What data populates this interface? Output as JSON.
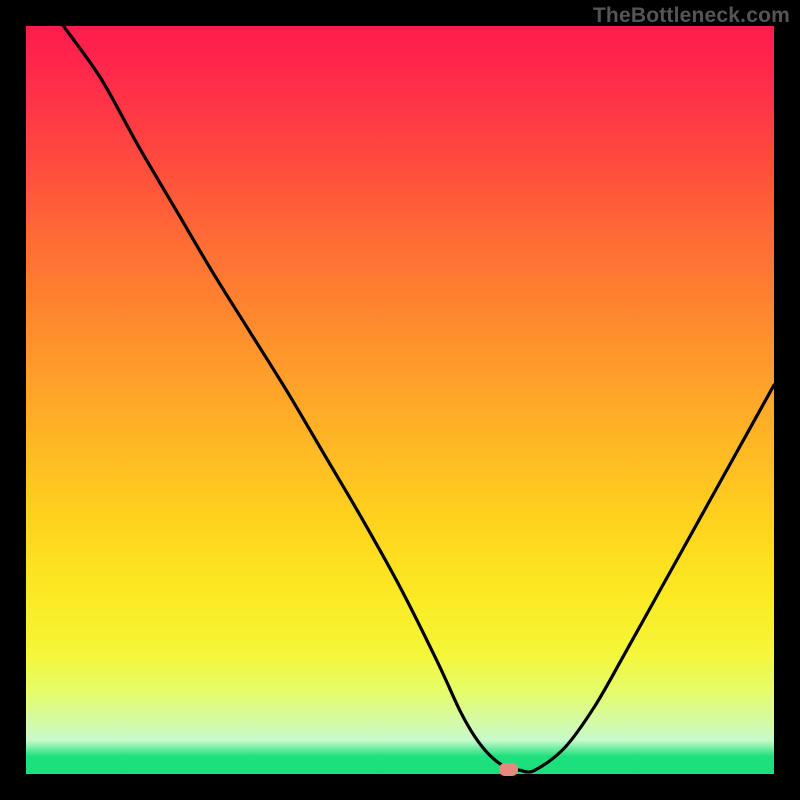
{
  "watermark": "TheBottleneck.com",
  "marker": {
    "x_pct": 64.5,
    "y_pct": 100
  },
  "chart_data": {
    "type": "line",
    "title": "",
    "xlabel": "",
    "ylabel": "",
    "xlim": [
      0,
      100
    ],
    "ylim": [
      0,
      100
    ],
    "grid": false,
    "legend": false,
    "background": "rainbow-vertical-gradient",
    "marker_x": 64.5,
    "series": [
      {
        "name": "bottleneck-curve",
        "x": [
          5,
          10,
          15,
          20,
          25,
          30,
          35,
          40,
          45,
          50,
          55,
          58,
          60,
          62,
          64,
          66,
          68,
          72,
          76,
          80,
          85,
          90,
          95,
          100
        ],
        "y": [
          100,
          93,
          84,
          75.5,
          67,
          59,
          51,
          42.5,
          34,
          25,
          15,
          8.5,
          5,
          2.5,
          1,
          0.5,
          0.5,
          3.5,
          9,
          16,
          25,
          34,
          43,
          52
        ]
      }
    ],
    "colors": {
      "curve": "#000000",
      "marker": "#e8887f"
    }
  }
}
